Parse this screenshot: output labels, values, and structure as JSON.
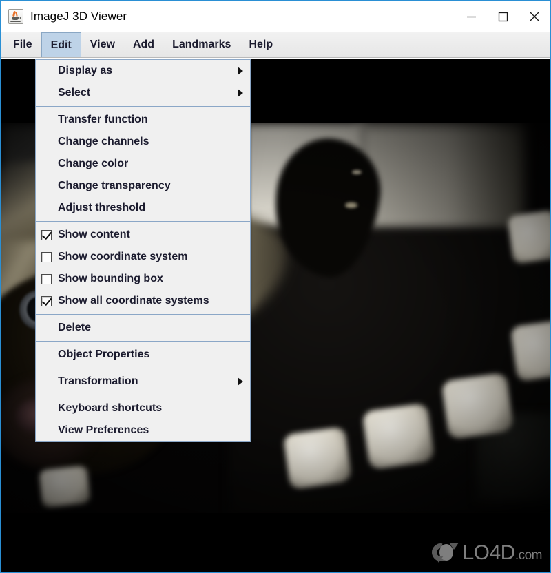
{
  "window": {
    "title": "ImageJ 3D Viewer",
    "app_icon": "java-coffee-cup-icon",
    "border_color": "#2a8fd4",
    "controls": {
      "minimize": "minimize-icon",
      "maximize": "maximize-icon",
      "close": "close-icon"
    }
  },
  "menubar": {
    "items": [
      {
        "label": "File",
        "active": false
      },
      {
        "label": "Edit",
        "active": true
      },
      {
        "label": "View",
        "active": false
      },
      {
        "label": "Add",
        "active": false
      },
      {
        "label": "Landmarks",
        "active": false
      },
      {
        "label": "Help",
        "active": false
      }
    ]
  },
  "edit_menu": {
    "groups": [
      {
        "items": [
          {
            "label": "Display as",
            "submenu": true,
            "type": "item"
          },
          {
            "label": "Select",
            "submenu": true,
            "type": "item"
          }
        ]
      },
      {
        "items": [
          {
            "label": "Transfer function",
            "submenu": false,
            "type": "item"
          },
          {
            "label": "Change channels",
            "submenu": false,
            "type": "item"
          },
          {
            "label": "Change color",
            "submenu": false,
            "type": "item"
          },
          {
            "label": "Change transparency",
            "submenu": false,
            "type": "item"
          },
          {
            "label": "Adjust threshold",
            "submenu": false,
            "type": "item"
          }
        ]
      },
      {
        "items": [
          {
            "label": "Show content",
            "type": "checkbox",
            "checked": true
          },
          {
            "label": "Show coordinate system",
            "type": "checkbox",
            "checked": false
          },
          {
            "label": "Show bounding box",
            "type": "checkbox",
            "checked": false
          },
          {
            "label": "Show all coordinate systems",
            "type": "checkbox",
            "checked": true
          }
        ]
      },
      {
        "items": [
          {
            "label": "Delete",
            "submenu": false,
            "type": "item"
          }
        ]
      },
      {
        "items": [
          {
            "label": "Object Properties",
            "submenu": false,
            "type": "item"
          }
        ]
      },
      {
        "items": [
          {
            "label": "Transformation",
            "submenu": true,
            "type": "item"
          }
        ]
      },
      {
        "items": [
          {
            "label": "Keyboard shortcuts",
            "submenu": false,
            "type": "item"
          },
          {
            "label": "View Preferences",
            "submenu": false,
            "type": "item"
          }
        ]
      }
    ]
  },
  "canvas": {
    "description": "3D viewer rendering of a photograph of a Siamese cat lying on a dark couch with a white fuzzy blanket",
    "background_color": "#000000"
  },
  "watermark": {
    "name": "LO4D",
    "suffix": ".com",
    "color": "#9b9b9b"
  }
}
